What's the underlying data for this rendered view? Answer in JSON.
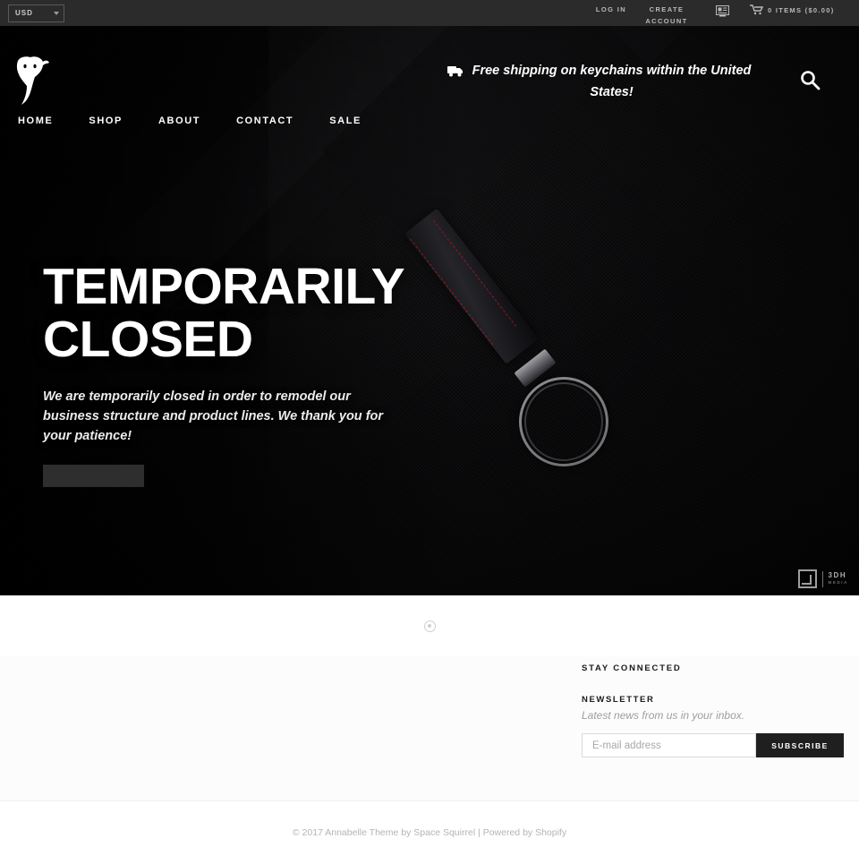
{
  "topbar": {
    "currency": {
      "value": "USD",
      "caret_icon": "chevron-down-icon"
    },
    "login_label": "LOG IN",
    "create_account_label": "CREATE ACCOUNT",
    "register_icon": "card-register-icon",
    "cart_icon": "shopping-cart-icon",
    "cart_label": "0 ITEMS ($0.00)"
  },
  "header": {
    "logo_icon": "bull-head-logo",
    "nav": [
      {
        "label": "HOME"
      },
      {
        "label": "SHOP"
      },
      {
        "label": "ABOUT"
      },
      {
        "label": "CONTACT"
      },
      {
        "label": "SALE"
      }
    ],
    "shipping_icon": "delivery-truck-icon",
    "shipping_text": "Free shipping on keychains within the United States!",
    "search_icon": "search-icon"
  },
  "hero": {
    "title_line1": "TEMPORARILY",
    "title_line2": "CLOSED",
    "subtitle": "We are temporarily closed in order to remodel our business structure and product lines. We thank you for your patience!",
    "cta_label": "",
    "watermark": {
      "mark_icon": "bracket-square-icon",
      "primary": "3DH",
      "secondary": "MEDIA"
    }
  },
  "carousel": {
    "dot_icon": "carousel-dot-icon"
  },
  "footer": {
    "stay_connected_title": "STAY CONNECTED",
    "newsletter_title": "NEWSLETTER",
    "newsletter_subtitle": "Latest news from us in your inbox.",
    "email_placeholder": "E-mail address",
    "email_value": "",
    "subscribe_label": "SUBSCRIBE"
  },
  "copyright": {
    "text": "© 2017 Annabelle Theme by Space Squirrel | Powered by Shopify"
  },
  "colors": {
    "topbar_bg": "#2b2b2b",
    "hero_bg": "#0a0a0c",
    "accent_red": "#be1e28",
    "button_dark": "#1f1f1f",
    "cta_grey": "#2e2e2e"
  }
}
